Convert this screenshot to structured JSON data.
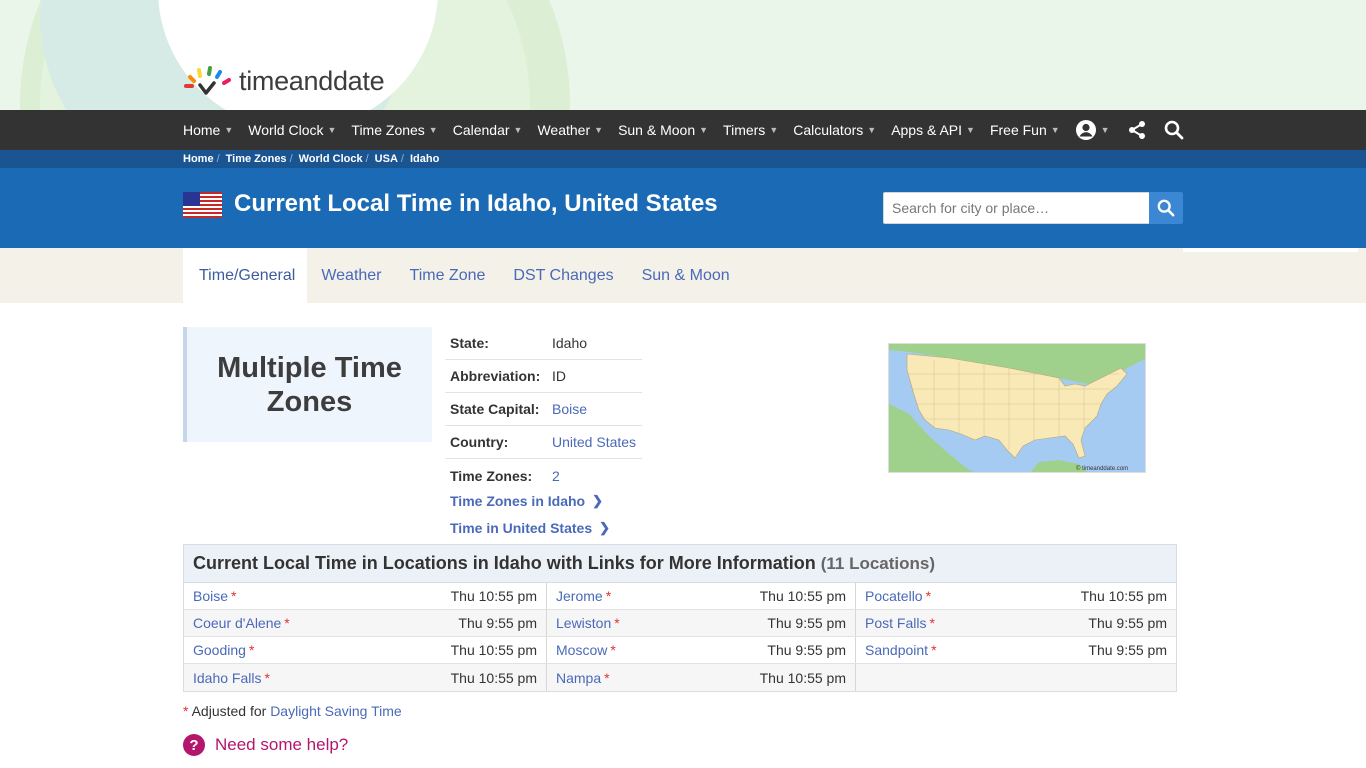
{
  "brand": {
    "logo_text": "timeanddate"
  },
  "nav": {
    "items": [
      "Home",
      "World Clock",
      "Time Zones",
      "Calendar",
      "Weather",
      "Sun & Moon",
      "Timers",
      "Calculators",
      "Apps & API",
      "Free Fun"
    ],
    "icons": [
      "account-icon",
      "share-icon",
      "search-icon"
    ]
  },
  "breadcrumb": [
    "Home",
    "Time Zones",
    "World Clock",
    "USA",
    "Idaho"
  ],
  "header": {
    "title": "Current Local Time in Idaho, United States",
    "search_placeholder": "Search for city or place…"
  },
  "tabs": [
    "Time/General",
    "Weather",
    "Time Zone",
    "DST Changes",
    "Sun & Moon"
  ],
  "active_tab": "Time/General",
  "multiple_tz": "Multiple Time Zones",
  "info": {
    "state": {
      "label": "State:",
      "value": "Idaho"
    },
    "abbreviation": {
      "label": "Abbreviation:",
      "value": "ID"
    },
    "capital": {
      "label": "State Capital:",
      "value": "Boise"
    },
    "country": {
      "label": "Country:",
      "value": "United States"
    },
    "time_zones": {
      "label": "Time Zones:",
      "value": "2"
    },
    "link_tz": "Time Zones in Idaho",
    "link_country": "Time in United States"
  },
  "map": {
    "copyright": "© timeanddate.com"
  },
  "locations": {
    "heading": "Current Local Time in Locations in Idaho with Links for More Information",
    "count": "(11 Locations)",
    "rows": [
      [
        {
          "city": "Boise",
          "time": "Thu 10:55 pm"
        },
        {
          "city": "Jerome",
          "time": "Thu 10:55 pm"
        },
        {
          "city": "Pocatello",
          "time": "Thu 10:55 pm"
        }
      ],
      [
        {
          "city": "Coeur d'Alene",
          "time": "Thu 9:55 pm"
        },
        {
          "city": "Lewiston",
          "time": "Thu 9:55 pm"
        },
        {
          "city": "Post Falls",
          "time": "Thu 9:55 pm"
        }
      ],
      [
        {
          "city": "Gooding",
          "time": "Thu 10:55 pm"
        },
        {
          "city": "Moscow",
          "time": "Thu 9:55 pm"
        },
        {
          "city": "Sandpoint",
          "time": "Thu 9:55 pm"
        }
      ],
      [
        {
          "city": "Idaho Falls",
          "time": "Thu 10:55 pm"
        },
        {
          "city": "Nampa",
          "time": "Thu 10:55 pm"
        },
        {
          "city": "",
          "time": ""
        }
      ]
    ]
  },
  "note": {
    "star": "*",
    "text": "Adjusted for",
    "link": "Daylight Saving Time"
  },
  "help": {
    "icon_text": "?",
    "text": "Need some help?"
  },
  "colors": {
    "nav_bg": "#333333",
    "title_bar": "#1a6ab5",
    "breadcrumb_bg": "#1a5591",
    "link": "#4a69b9",
    "help": "#b3166c"
  }
}
